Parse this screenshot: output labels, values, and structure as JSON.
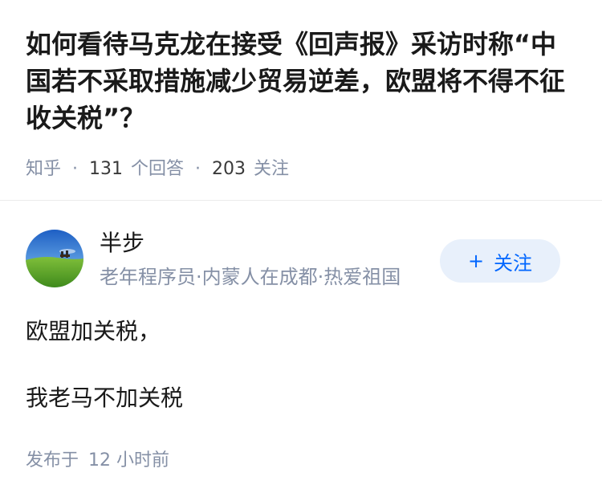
{
  "question": {
    "title": "如何看待马克龙在接受《回声报》采访时称“中国若不采取措施减少贸易逆差，欧盟将不得不征收关税”？",
    "source": "知乎",
    "answer_count": "131",
    "answer_count_label": "个回答",
    "follower_count": "203",
    "follower_count_label": "关注",
    "separator": "·"
  },
  "author": {
    "name": "半步",
    "bio": "老年程序员·内蒙人在成都·热爱祖国",
    "avatar_icon": "landscape-avatar-icon",
    "follow_label": "关注",
    "follow_plus": "+"
  },
  "answer": {
    "lines": [
      "欧盟加关税，",
      "我老马不加关税"
    ],
    "published_label": "发布于",
    "published_time": "12 小时前"
  },
  "colors": {
    "title": "#1a1a1a",
    "meta": "#8590a6",
    "follow_bg": "#e8f0fb",
    "follow_text": "#0066ff",
    "divider": "#ebebeb"
  }
}
